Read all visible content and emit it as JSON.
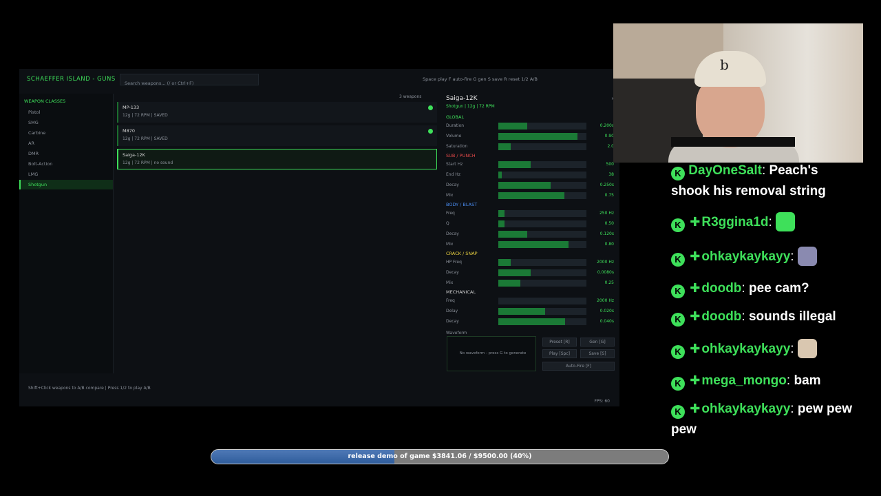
{
  "app": {
    "title": "SCHAEFFER ISLAND - GUNS",
    "search_placeholder": "Search weapons... (/ or Ctrl+F)",
    "hints": "Space play  F auto-fire  G gen  S save  R reset  1/2 A/B",
    "footer_hint": "Shift+Click weapons to A/B compare | Press 1/2 to play A/B",
    "fps": "FPS: 60"
  },
  "sidebar": {
    "header": "WEAPON CLASSES",
    "items": [
      {
        "label": "Pistol"
      },
      {
        "label": "SMG"
      },
      {
        "label": "Carbine"
      },
      {
        "label": "AR"
      },
      {
        "label": "DMR"
      },
      {
        "label": "Bolt-Action"
      },
      {
        "label": "LMG"
      },
      {
        "label": "Shotgun"
      }
    ],
    "active_index": 7
  },
  "weapons": {
    "count": "3 weapons",
    "items": [
      {
        "name": "MP-133",
        "meta": "12g | 72 RPM | SAVED",
        "saved": true
      },
      {
        "name": "M870",
        "meta": "12g | 72 RPM | SAVED",
        "saved": true
      },
      {
        "name": "Saiga-12K",
        "meta": "12g | 72 RPM | no sound",
        "saved": false
      }
    ]
  },
  "details": {
    "title": "Saiga-12K",
    "subtitle": "Shotgun | 12g | 72 RPM",
    "close": "×",
    "sections": [
      {
        "name": "GLOBAL",
        "color": "#3ee05a",
        "params": [
          {
            "label": "Duration",
            "value": "0.200s",
            "fill": 0.33
          },
          {
            "label": "Volume",
            "value": "0.90",
            "fill": 0.9
          },
          {
            "label": "Saturation",
            "value": "2.0",
            "fill": 0.14
          }
        ]
      },
      {
        "name": "SUB / PUNCH",
        "color": "#e04848",
        "params": [
          {
            "label": "Start Hz",
            "value": "500",
            "fill": 0.37
          },
          {
            "label": "End Hz",
            "value": "38",
            "fill": 0.04
          },
          {
            "label": "Decay",
            "value": "0.250s",
            "fill": 0.59
          },
          {
            "label": "Mix",
            "value": "0.75",
            "fill": 0.75
          }
        ]
      },
      {
        "name": "BODY / BLAST",
        "color": "#4a8cf0",
        "params": [
          {
            "label": "Freq",
            "value": "250 Hz",
            "fill": 0.07
          },
          {
            "label": "Q",
            "value": "0.50",
            "fill": 0.07
          },
          {
            "label": "Decay",
            "value": "0.120s",
            "fill": 0.33
          },
          {
            "label": "Mix",
            "value": "0.80",
            "fill": 0.8
          }
        ]
      },
      {
        "name": "CRACK / SNAP",
        "color": "#e8d040",
        "params": [
          {
            "label": "HP Freq",
            "value": "2000 Hz",
            "fill": 0.14
          },
          {
            "label": "Decay",
            "value": "0.0080s",
            "fill": 0.37
          },
          {
            "label": "Mix",
            "value": "0.25",
            "fill": 0.25
          }
        ]
      },
      {
        "name": "MECHANICAL",
        "color": "#cfcfcf",
        "params": [
          {
            "label": "Freq",
            "value": "2000 Hz",
            "fill": 0.0
          },
          {
            "label": "Delay",
            "value": "0.020s",
            "fill": 0.53
          },
          {
            "label": "Decay",
            "value": "0.040s",
            "fill": 0.76
          }
        ]
      }
    ],
    "waveform_label": "Waveform",
    "waveform_empty": "No waveform - press G to generate",
    "buttons": {
      "preset": "Preset [R]",
      "gen": "Gen [G]",
      "play": "Play [Spc]",
      "save": "Save [S]",
      "autofire": "Auto-Fire [F]"
    }
  },
  "chat": [
    {
      "user": "DayOneSalt",
      "text": "Peach's shook his removal string",
      "plus": false
    },
    {
      "user": "R3ggina1d",
      "text": "",
      "plus": true,
      "emote": "#3ee05a"
    },
    {
      "user": "ohkaykaykayy",
      "text": "",
      "plus": true,
      "emote": "#8a8ab0"
    },
    {
      "user": "doodb",
      "text": "pee cam?",
      "plus": true
    },
    {
      "user": "doodb",
      "text": "sounds illegal",
      "plus": true
    },
    {
      "user": "ohkaykaykayy",
      "text": "",
      "plus": true,
      "emote": "#d9c7b0"
    },
    {
      "user": "mega_mongo",
      "text": "bam",
      "plus": true
    },
    {
      "user": "ohkaykaykayy",
      "text": "pew pew pew",
      "plus": true
    }
  ],
  "goal": {
    "text": "release demo of game $3841.06 / $9500.00 (40%)",
    "progress": 0.4,
    "fill_color": "#3e6fb0"
  }
}
